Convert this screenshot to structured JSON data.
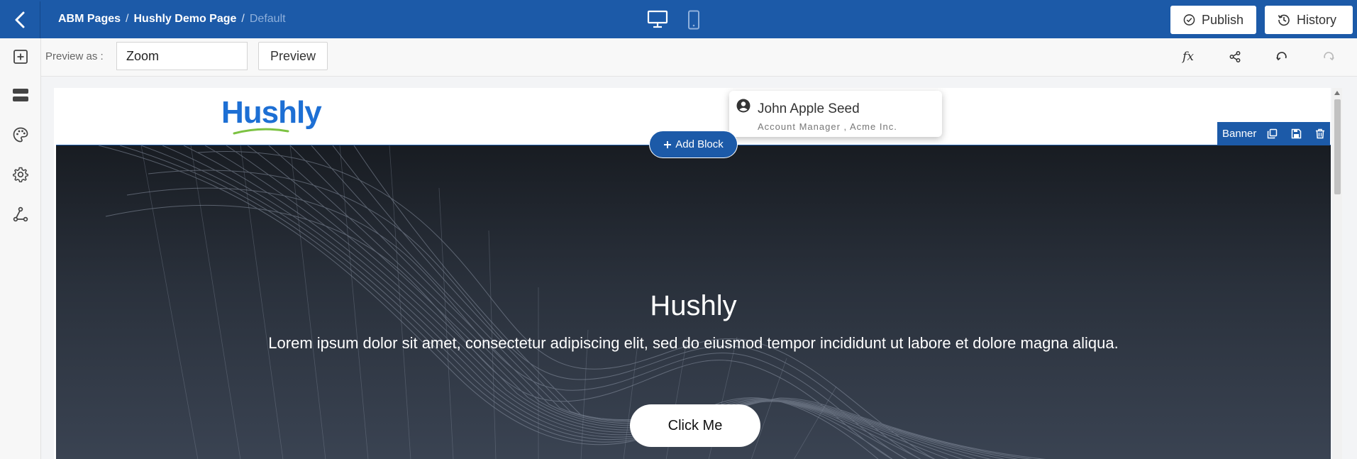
{
  "header": {
    "breadcrumb": [
      "ABM Pages",
      "Hushly Demo Page",
      "Default"
    ],
    "separator": "/",
    "publish_label": "Publish",
    "history_label": "History"
  },
  "toolbar": {
    "preview_as_label": "Preview as :",
    "zoom_value": "Zoom",
    "preview_button": "Preview",
    "fx_label": "fx"
  },
  "page": {
    "logo_text": "Hushly",
    "profile": {
      "name": "John Apple Seed",
      "subtitle": "Account Manager , Acme Inc."
    },
    "banner": {
      "title": "Hushly",
      "text": "Lorem ipsum dolor sit amet, consectetur adipiscing elit, sed do eiusmod tempor incididunt ut labore et dolore magna aliqua.",
      "cta": "Click Me"
    }
  },
  "editor": {
    "add_block_label": "Add Block",
    "block_tag_label": "Banner"
  },
  "colors": {
    "primary": "#1c5aa8",
    "banner_dark": "#181c22",
    "logo_blue": "#1d6fd4",
    "logo_green": "#7cc242"
  },
  "icons": {
    "sidebar": [
      "add-square-icon",
      "layers-icon",
      "palette-icon",
      "settings-icon",
      "flow-icon"
    ],
    "toolbar": [
      "fx-icon",
      "share-icon",
      "undo-icon",
      "redo-icon"
    ],
    "devices": [
      "desktop-icon",
      "mobile-icon"
    ]
  }
}
